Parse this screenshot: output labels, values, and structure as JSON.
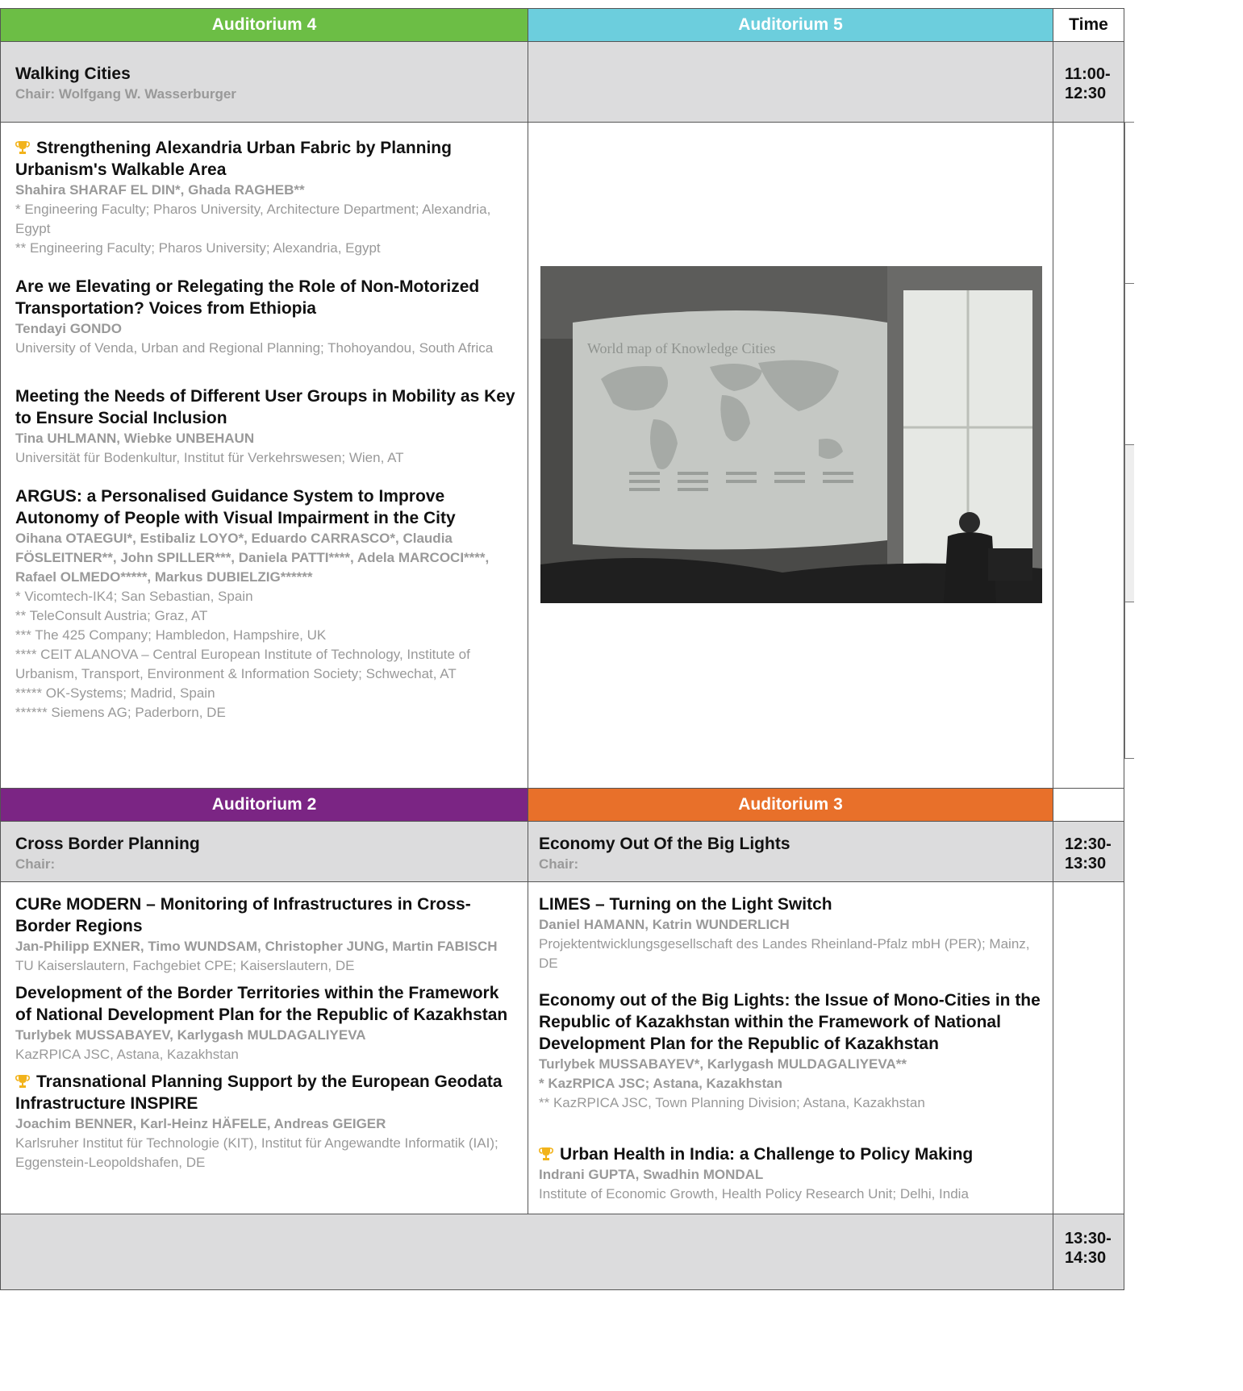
{
  "colors": {
    "aud4": "#6cbe45",
    "aud5": "#6ccedd",
    "aud2": "#7b2584",
    "aud3": "#e8702a",
    "gray": "#dcdcdd"
  },
  "header_top": {
    "aud4": "Auditorium 4",
    "aud5": "Auditorium 5",
    "time": "Time"
  },
  "session1": {
    "title": "Walking Cities",
    "chair": "Chair: Wolfgang W. Wasserburger",
    "time": "11:00-12:30"
  },
  "papers_aud4": [
    {
      "icon": "trophy-icon",
      "title": "Strengthening Alexandria Urban Fabric by Planning Urbanism's Walkable Area",
      "authors": "Shahira SHARAF EL DIN*, Ghada RAGHEB**",
      "aff": [
        "* Engineering Faculty; Pharos University, Architecture Department; Alexandria, Egypt",
        "** Engineering Faculty; Pharos University; Alexandria, Egypt"
      ]
    },
    {
      "title": "Are we Elevating or Relegating the Role of Non-Motorized Transportation? Voices from Ethiopia",
      "authors": "Tendayi GONDO",
      "aff": [
        "University of Venda, Urban and Regional Planning; Thohoyandou, South Africa"
      ]
    },
    {
      "title": "Meeting the Needs of Different User Groups in Mobility as Key to Ensure Social Inclusion",
      "authors": "Tina UHLMANN, Wiebke UNBEHAUN",
      "aff": [
        "Universität für Bodenkultur, Institut für Verkehrswesen; Wien, AT"
      ]
    },
    {
      "title": "ARGUS: a Personalised Guidance System to Improve Autonomy of People with Visual Impairment in the City",
      "authors": "Oihana OTAEGUI*, Estibaliz LOYO*, Eduardo CARRASCO*, Claudia FÖSLEITNER**, John SPILLER***, Daniela PATTI****, Adela MARCOCI****, Rafael OLMEDO*****, Markus DUBIELZIG******",
      "aff": [
        "* Vicomtech-IK4; San Sebastian, Spain",
        "** TeleConsult Austria; Graz, AT",
        "*** The 425 Company; Hambledon, Hampshire, UK",
        "**** CEIT ALANOVA – Central European Institute of Technology, Institute of Urbanism, Transport, Environment & Information Society; Schwechat, AT",
        "***** OK-Systems; Madrid, Spain",
        "****** Siemens AG; Paderborn, DE"
      ]
    }
  ],
  "photo": {
    "screen_text": "World map of Knowledge Cities"
  },
  "header_mid": {
    "aud2": "Auditorium 2",
    "aud3": "Auditorium 3"
  },
  "session2": {
    "aud2_title": "Cross Border Planning",
    "aud2_chair": "Chair:",
    "aud3_title": "Economy Out Of the Big Lights",
    "aud3_chair": "Chair:",
    "time": "12:30-13:30"
  },
  "papers_aud2": [
    {
      "title": "CURe MODERN – Monitoring of Infrastructures in Cross-Border Regions",
      "authors": "Jan-Philipp EXNER, Timo WUNDSAM, Christopher JUNG, Martin FABISCH",
      "aff": [
        "TU Kaiserslautern, Fachgebiet CPE; Kaiserslautern, DE"
      ]
    },
    {
      "title": "Development of the Border Territories within the Framework of National Development Plan for the Republic of Kazakhstan",
      "authors": "Turlybek MUSSABAYEV, Karlygash MULDAGALIYEVA",
      "aff": [
        "KazRPICA JSC, Astana, Kazakhstan"
      ]
    },
    {
      "icon": "trophy-icon",
      "title": "Transnational Planning Support by the European Geodata Infrastructure INSPIRE",
      "authors": "Joachim BENNER, Karl-Heinz HÄFELE, Andreas GEIGER",
      "aff": [
        "Karlsruher Institut für Technologie (KIT), Institut für Angewandte Informatik (IAI); Eggenstein-Leopoldshafen, DE"
      ]
    }
  ],
  "papers_aud3": [
    {
      "title": "LIMES – Turning on the Light Switch",
      "authors": "Daniel HAMANN, Katrin WUNDERLICH",
      "aff": [
        "Projektentwicklungsgesellschaft des Landes Rheinland-Pfalz mbH (PER); Mainz, DE"
      ]
    },
    {
      "title": "Economy out of the Big Lights: the Issue of Mono-Cities in the Republic of Kazakhstan within the Framework of National Development Plan for the Republic of Kazakhstan",
      "authors": "Turlybek MUSSABAYEV*, Karlygash MULDAGALIYEVA**",
      "aff_bold": "* KazRPICA JSC; Astana, Kazakhstan",
      "aff": [
        "** KazRPICA JSC, Town Planning Division; Astana, Kazakhstan"
      ]
    },
    {
      "icon": "trophy-icon",
      "title": "Urban Health in India: a Challenge to Policy Making",
      "authors": "Indrani GUPTA, Swadhin MONDAL",
      "aff": [
        "Institute of Economic Growth, Health Policy Research Unit; Delhi, India"
      ]
    }
  ],
  "session3": {
    "time": "13:30-14:30"
  }
}
